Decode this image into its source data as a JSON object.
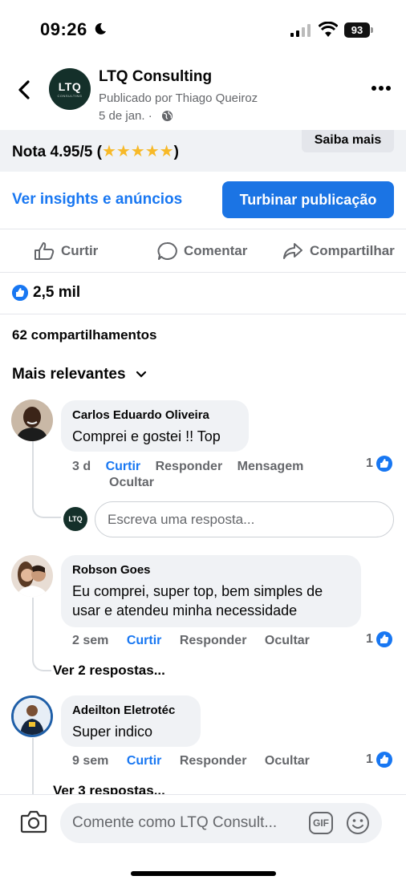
{
  "status_bar": {
    "time": "09:26",
    "battery": "93"
  },
  "post": {
    "page_name": "LTQ Consulting",
    "posted_by": "Publicado por Thiago Queiroz",
    "date": "5 de jan. ·",
    "avatar_text": "LTQ",
    "avatar_subtext": "CONSULTING"
  },
  "ad": {
    "rating_text": "Nota 4.95/5 (",
    "stars": "★★★★★",
    "rating_close": ")",
    "learn_more": "Saiba mais"
  },
  "insights": {
    "link": "Ver insights e anúncios",
    "boost": "Turbinar publicação"
  },
  "actions": {
    "like": "Curtir",
    "comment": "Comentar",
    "share": "Compartilhar"
  },
  "reactions": {
    "count": "2,5 mil"
  },
  "shares": "62 compartilhamentos",
  "filter": "Mais relevantes",
  "comments": [
    {
      "author": "Carlos Eduardo Oliveira",
      "text": "Comprei e gostei !! Top",
      "time": "3 d",
      "like": "Curtir",
      "reply": "Responder",
      "message": "Mensagem",
      "hide": "Ocultar",
      "likes": "1"
    },
    {
      "author": "Robson Goes",
      "text": "Eu comprei, super top, bem simples de usar e atendeu minha necessidade",
      "time": "2 sem",
      "like": "Curtir",
      "reply": "Responder",
      "hide": "Ocultar",
      "likes": "1",
      "view_replies": "Ver 2 respostas..."
    },
    {
      "author": "Adeilton Eletrotéc",
      "text": "Super indico",
      "time": "9 sem",
      "like": "Curtir",
      "reply": "Responder",
      "hide": "Ocultar",
      "likes": "1",
      "view_replies": "Ver 3 respostas..."
    }
  ],
  "reply_box": {
    "avatar_text": "LTQ",
    "placeholder": "Escreva uma resposta..."
  },
  "composer": {
    "placeholder": "Comente como LTQ Consult...",
    "gif": "GIF"
  },
  "colors": {
    "accent": "#1877f2",
    "bubble": "#f0f2f5",
    "secondary_text": "#65676b"
  }
}
